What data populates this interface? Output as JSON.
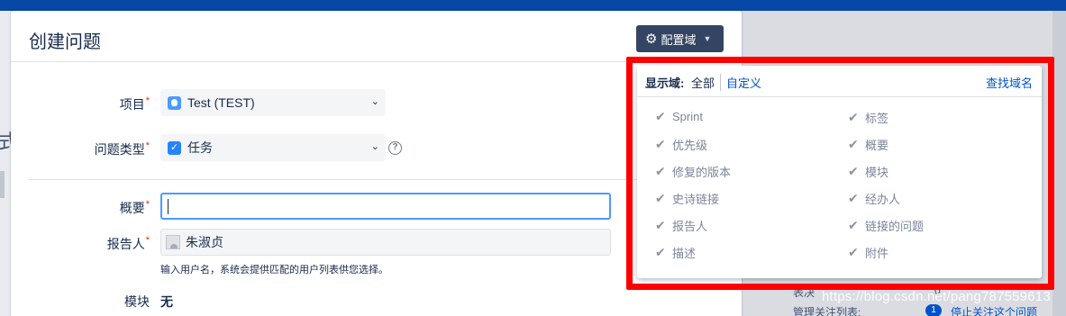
{
  "dialog": {
    "title": "创建问题",
    "configure_button": "配置域",
    "fields": {
      "project": {
        "label": "项目",
        "value": "Test (TEST)"
      },
      "issue_type": {
        "label": "问题类型",
        "value": "任务"
      },
      "summary": {
        "label": "概要",
        "value": ""
      },
      "reporter": {
        "label": "报告人",
        "value": "朱淑贞",
        "hint": "输入用户名，系统会提供匹配的用户列表供您选择。"
      },
      "component": {
        "label": "模块",
        "value": "无"
      }
    },
    "required_mark": "*",
    "help_icon": "?"
  },
  "field_config_popup": {
    "show_label": "显示域:",
    "all": "全部",
    "custom": "自定义",
    "find": "查找域名",
    "left_fields": [
      "Sprint",
      "优先级",
      "修复的版本",
      "史诗链接",
      "报告人",
      "描述"
    ],
    "right_fields": [
      "标签",
      "概要",
      "模块",
      "经办人",
      "链接的问题",
      "附件"
    ]
  },
  "background": {
    "left_glyph": "式",
    "tail_label": "表决",
    "tail_value": "0",
    "manage_label": "管理关注列表:",
    "badge": "1",
    "stop_watch": "停止关注这个问题"
  },
  "watermark": "https://blog.csdn.net/pang787559613",
  "colors": {
    "highlight": "#ff0000",
    "link": "#0052cc",
    "button_dark": "#344563"
  }
}
